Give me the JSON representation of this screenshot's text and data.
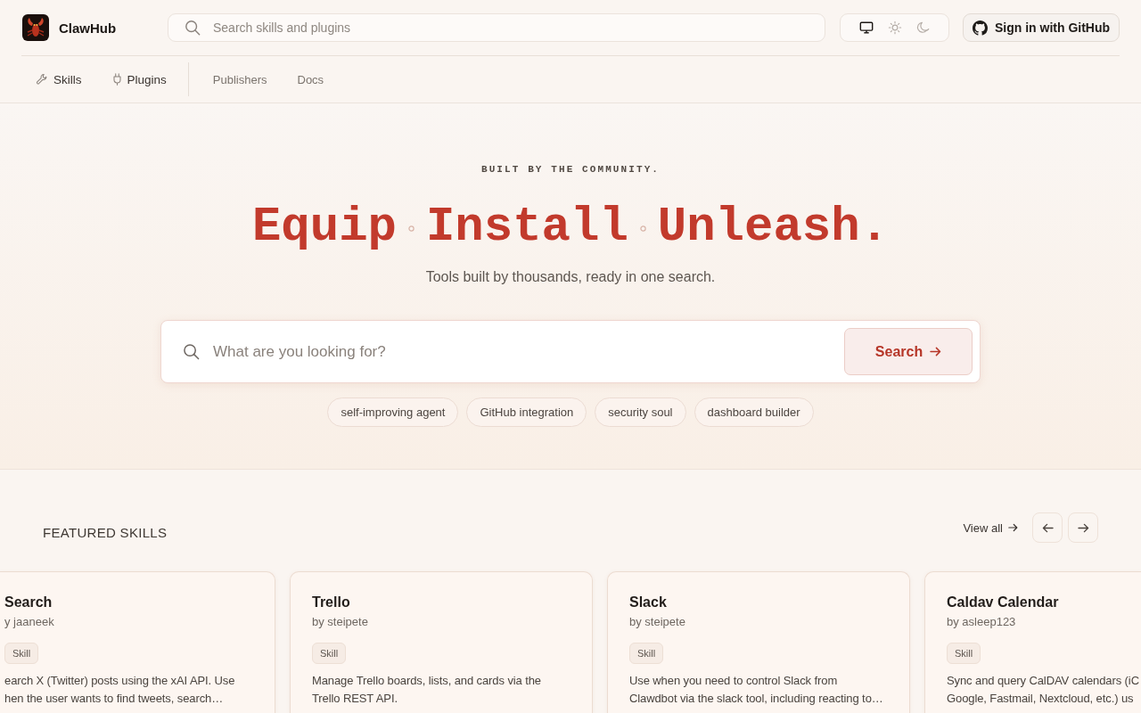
{
  "header": {
    "brand": "ClawHub",
    "search": {
      "placeholder": "Search skills and plugins"
    },
    "theme_switch": [
      {
        "selected": true
      },
      {
        "selected": false
      },
      {
        "selected": false
      }
    ],
    "sign_in": "Sign in with GitHub"
  },
  "nav": {
    "skills": "Skills",
    "plugins": "Plugins",
    "links": [
      "Publishers",
      "Docs"
    ]
  },
  "hero": {
    "eyebrow": "BUILT BY THE COMMUNITY.",
    "headline": [
      "Equip",
      "Install",
      "Unleash."
    ],
    "subtitle": "Tools built by thousands, ready in one search.",
    "search": {
      "placeholder": "What are you looking for?",
      "button": "Search"
    },
    "suggestions": [
      "self-improving agent",
      "GitHub integration",
      "security soul",
      "dashboard builder"
    ]
  },
  "featured": {
    "title": "FEATURED SKILLS",
    "view_all": "View all",
    "cards": [
      {
        "title": "Search",
        "author": "y jaaneek",
        "badge": "Skill",
        "description": [
          "earch X (Twitter) posts using the xAI API. Use",
          "hen the user wants to find tweets, search…"
        ]
      },
      {
        "title": "Trello",
        "author": "by steipete",
        "badge": "Skill",
        "description": [
          "Manage Trello boards, lists, and cards via the",
          "Trello REST API."
        ]
      },
      {
        "title": "Slack",
        "author": "by steipete",
        "badge": "Skill",
        "description": [
          "Use when you need to control Slack from",
          "Clawdbot via the slack tool, including reacting to…"
        ]
      },
      {
        "title": "Caldav Calendar",
        "author": "by asleep123",
        "badge": "Skill",
        "description": [
          "Sync and query CalDAV calendars (iC",
          "Google, Fastmail, Nextcloud, etc.) us"
        ]
      }
    ]
  }
}
